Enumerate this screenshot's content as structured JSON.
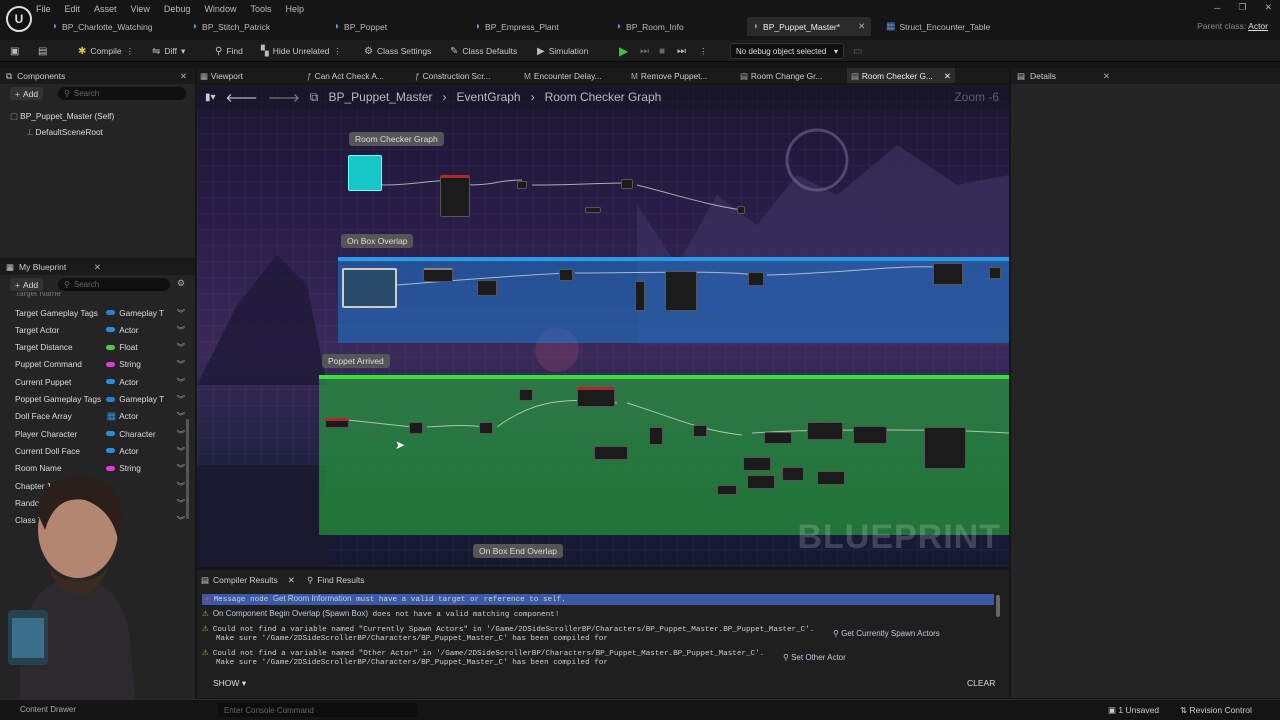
{
  "menu": [
    "File",
    "Edit",
    "Asset",
    "View",
    "Debug",
    "Window",
    "Tools",
    "Help"
  ],
  "logo": "U",
  "doc_tabs": [
    {
      "label": "BP_Charlotte_Watching"
    },
    {
      "label": "BP_Stitch_Patrick"
    },
    {
      "label": "BP_Poppet"
    },
    {
      "label": "BP_Empress_Plant"
    },
    {
      "label": "BP_Room_Info"
    },
    {
      "label": "BP_Puppet_Master*",
      "active": true
    },
    {
      "label": "Struct_Encounter_Table"
    }
  ],
  "parent_class": {
    "label": "Parent class:",
    "value": "Actor"
  },
  "toolbar": {
    "compile": "Compile",
    "diff": "Diff",
    "find": "Find",
    "hide_unrelated": "Hide Unrelated",
    "class_settings": "Class Settings",
    "class_defaults": "Class Defaults",
    "simulation": "Simulation",
    "debug_object": "No debug object selected"
  },
  "components": {
    "title": "Components",
    "add": "Add",
    "search_placeholder": "Search",
    "self": "BP_Puppet_Master (Self)",
    "root": "DefaultSceneRoot"
  },
  "my_blueprint": {
    "title": "My Blueprint",
    "add": "Add",
    "search_placeholder": "Search",
    "vars_cut_top": "Target Name",
    "vars": [
      {
        "name": "Target Gameplay Tags",
        "type": "Gameplay T",
        "color": "#2f7fd0"
      },
      {
        "name": "Target Actor",
        "type": "Actor",
        "color": "#2a8fd8"
      },
      {
        "name": "Target Distance",
        "type": "Float",
        "color": "#4fc64f"
      },
      {
        "name": "Puppet Command",
        "type": "String",
        "color": "#e03ad8"
      },
      {
        "name": "Current Puppet",
        "type": "Actor",
        "color": "#2a8fd8"
      },
      {
        "name": "Poppet Gameplay Tags",
        "type": "Gameplay T",
        "color": "#2f7fd0"
      },
      {
        "name": "Doll Face Array",
        "type": "Actor",
        "color": "#2a8fd8"
      },
      {
        "name": "Player Character",
        "type": "Character",
        "color": "#2a8fd8"
      },
      {
        "name": "Current Doll Face",
        "type": "Actor",
        "color": "#2a8fd8"
      },
      {
        "name": "Room Name",
        "type": "String",
        "color": "#e03ad8"
      },
      {
        "name": "Chapter 1 Encou",
        "type": "",
        "color": ""
      },
      {
        "name": "Random Loc",
        "type": "",
        "color": ""
      },
      {
        "name": "Class To",
        "type": "",
        "color": ""
      }
    ]
  },
  "graph_tabs": [
    "Viewport",
    "Can Act Check A...",
    "Construction Scr...",
    "Encounter Delay...",
    "Remove Puppet...",
    "Room Change Gr...",
    "Room Checker G..."
  ],
  "breadcrumb": {
    "root": "BP_Puppet_Master",
    "mid": "EventGraph",
    "current": "Room Checker Graph",
    "zoom": "Zoom -6"
  },
  "comments": {
    "room_checker": "Room Checker Graph",
    "box_overlap": "On Box Overlap",
    "poppet_arrived": "Poppet Arrived",
    "box_end_overlap": "On Box End Overlap"
  },
  "watermark": "BLUEPRINT",
  "details": {
    "title": "Details"
  },
  "bottom": {
    "tab_compiler": "Compiler Results",
    "tab_find": "Find Results",
    "show": "SHOW",
    "clear": "CLEAR",
    "m1a": "Message node",
    "m1link": "Get Room Information",
    "m1b": "must have a valid target or reference to self.",
    "m2link": "On Component Begin Overlap (Spawn Box)",
    "m2b": "does not have a valid matching component!",
    "m3a": "Could not find a variable named \"Currently Spawn Actors\" in '/Game/2DSideScrollerBP/Characters/BP_Puppet_Master.BP_Puppet_Master_C'.",
    "m3b": "Make sure '/Game/2DSideScrollerBP/Characters/BP_Puppet_Master_C' has been compiled for",
    "m3link": "Get Currently Spawn Actors",
    "m4a": "Could not find a variable named \"Other Actor\" in '/Game/2DSideScrollerBP/Characters/BP_Puppet_Master.BP_Puppet_Master_C'.",
    "m4b": "Make sure '/Game/2DSideScrollerBP/Characters/BP_Puppet_Master_C' has been compiled for",
    "m4link": "Set Other Actor"
  },
  "status": {
    "content_drawer": "Content Drawer",
    "console_placeholder": "Enter Console Command",
    "unsaved": "1 Unsaved",
    "revision": "Revision Control"
  }
}
